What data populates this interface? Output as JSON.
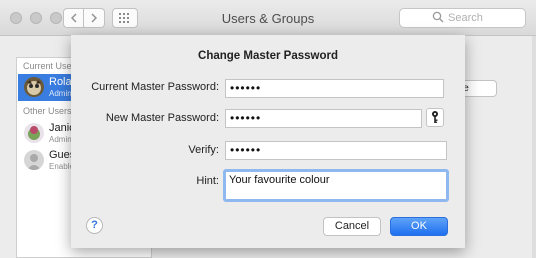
{
  "window": {
    "title": "Users & Groups",
    "search_placeholder": "Search",
    "nav_back_icon": "chevron-left-icon",
    "nav_forward_icon": "chevron-right-icon",
    "grid_icon": "grid-icon"
  },
  "sidebar": {
    "current_header": "Current User",
    "other_header": "Other Users",
    "users": [
      {
        "name": "Roland",
        "subtitle": "Admin",
        "selected": true
      },
      {
        "name": "Janice",
        "subtitle": "Admin",
        "selected": false
      },
      {
        "name": "Guest User",
        "subtitle": "Enabled",
        "selected": false
      }
    ]
  },
  "right_panel": {
    "partial_button_label": "Change Password..."
  },
  "dialog": {
    "title": "Change Master Password",
    "current_label": "Current Master Password:",
    "current_value": "••••••",
    "new_label": "New Master Password:",
    "new_value": "••••••",
    "verify_label": "Verify:",
    "verify_value": "••••••",
    "hint_label": "Hint:",
    "hint_value": "Your favourite colour",
    "help_label": "?",
    "cancel_label": "Cancel",
    "ok_label": "OK",
    "key_icon": "key-icon"
  },
  "colors": {
    "accent": "#2f76e0",
    "selection": "#3a7de0",
    "focus_ring": "#8fb8ef"
  }
}
